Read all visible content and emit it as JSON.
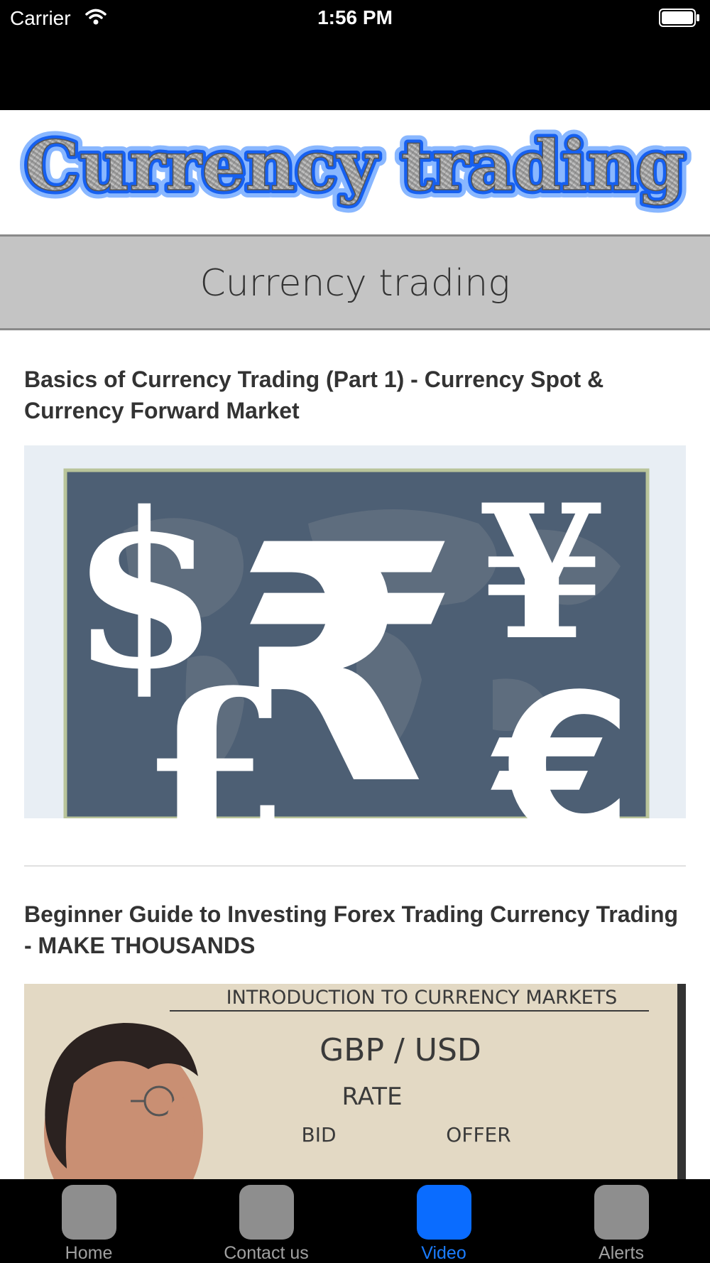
{
  "status_bar": {
    "carrier": "Carrier",
    "time": "1:56 PM"
  },
  "banner": {
    "logo_text": "Currency trading"
  },
  "page": {
    "title": "Currency trading"
  },
  "videos": [
    {
      "title": "Basics of Currency Trading (Part 1) - Currency Spot & Currency Forward Market",
      "thumbnail_icons": [
        "dollar-icon",
        "rupee-icon",
        "yen-icon",
        "pound-icon",
        "euro-icon"
      ]
    },
    {
      "title": "Beginner Guide to Investing Forex Trading Currency Trading - MAKE THOUSANDS",
      "whiteboard": {
        "heading": "INTRODUCTION TO CURRENCY MARKETS",
        "pair": "GBP / USD",
        "rate": "RATE",
        "bid": "BID",
        "offer": "OFFER"
      }
    }
  ],
  "tab_bar": {
    "tabs": [
      {
        "label": "Home",
        "active": false
      },
      {
        "label": "Contact us",
        "active": false
      },
      {
        "label": "Video",
        "active": true
      },
      {
        "label": "Alerts",
        "active": false
      }
    ],
    "active_color": "#0a6cff",
    "inactive_color": "#8e8e8e"
  }
}
